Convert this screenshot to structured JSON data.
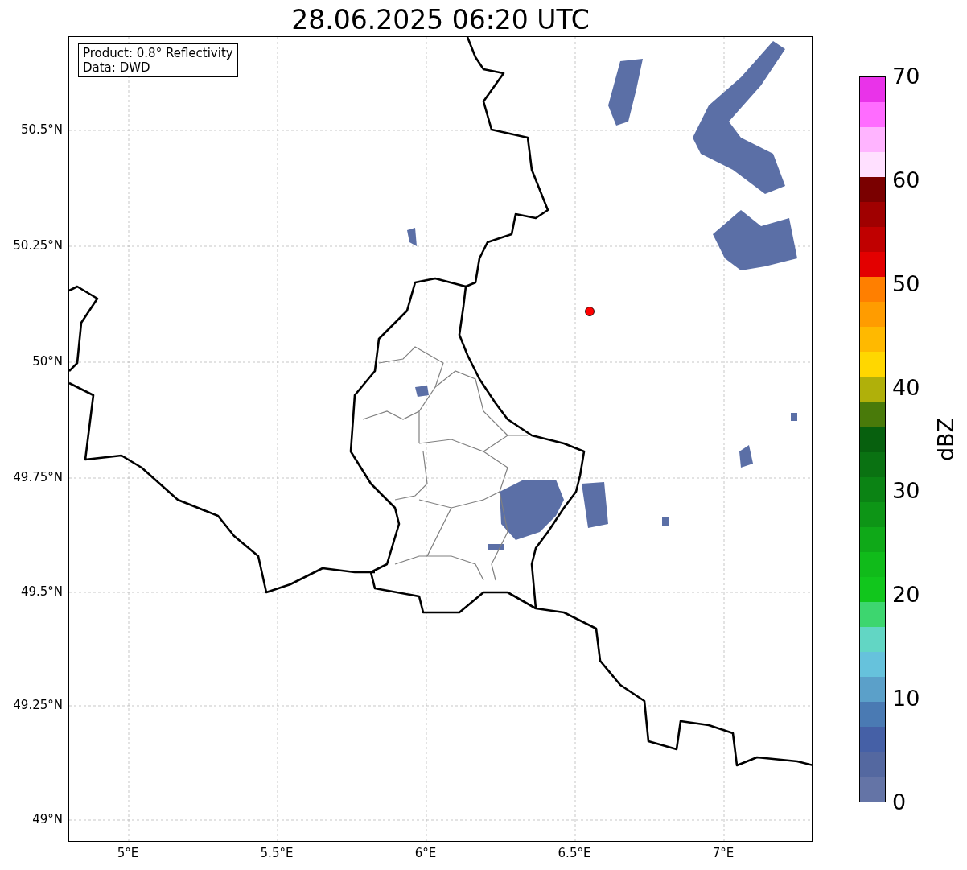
{
  "title": "28.06.2025 06:20 UTC",
  "map": {
    "legend": [
      "Product: 0.8° Reflectivity",
      "Data: DWD"
    ],
    "yticks": [
      "50.5°N",
      "50.25°N",
      "50°N",
      "49.75°N",
      "49.5°N",
      "49.25°N",
      "49°N"
    ],
    "xticks": [
      "5°E",
      "5.5°E",
      "6°E",
      "6.5°E",
      "7°E"
    ],
    "marker": {
      "color": "#ff0000"
    }
  },
  "colorbar": {
    "label": "dBZ",
    "ticks": [
      "70",
      "60",
      "50",
      "40",
      "30",
      "20",
      "10",
      "0"
    ],
    "bins": [
      {
        "color": "#6474a6"
      },
      {
        "color": "#5468a0"
      },
      {
        "color": "#4560a6"
      },
      {
        "color": "#4a7ab3"
      },
      {
        "color": "#5ba0c9"
      },
      {
        "color": "#66c2dc"
      },
      {
        "color": "#62d6c4"
      },
      {
        "color": "#3dd66f"
      },
      {
        "color": "#11c61c"
      },
      {
        "color": "#10bb1a"
      },
      {
        "color": "#0fa918"
      },
      {
        "color": "#0d9516"
      },
      {
        "color": "#0b8314"
      },
      {
        "color": "#0a7212"
      },
      {
        "color": "#07600e"
      },
      {
        "color": "#497a0a"
      },
      {
        "color": "#b0b00a"
      },
      {
        "color": "#ffd700"
      },
      {
        "color": "#ffb900"
      },
      {
        "color": "#ff9c00"
      },
      {
        "color": "#ff7f00"
      },
      {
        "color": "#e30000"
      },
      {
        "color": "#c00000"
      },
      {
        "color": "#a00000"
      },
      {
        "color": "#7a0000"
      },
      {
        "color": "#ffe0ff"
      },
      {
        "color": "#ffb4ff"
      },
      {
        "color": "#ff6cff"
      },
      {
        "color": "#e933e9"
      }
    ]
  }
}
